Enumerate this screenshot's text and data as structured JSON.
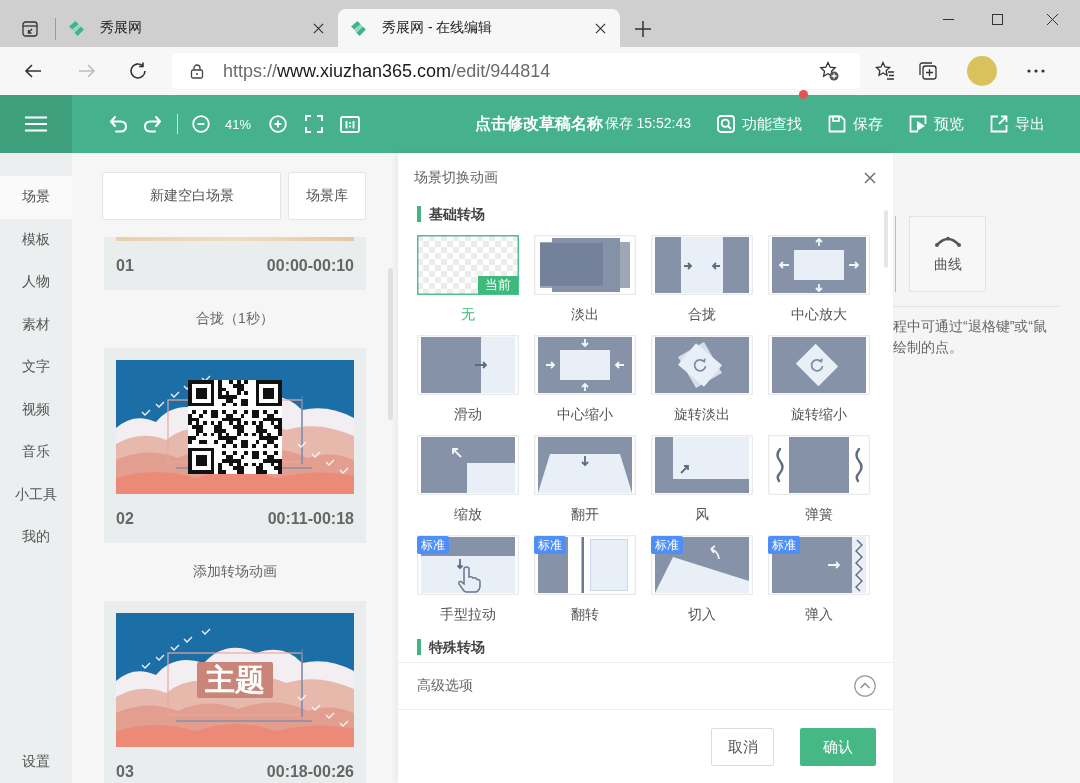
{
  "browser": {
    "tabs": [
      {
        "title": "秀展网",
        "selected": false
      },
      {
        "title": "秀展网 - 在线编辑",
        "selected": true
      }
    ],
    "nav": [
      {
        "kind": "back",
        "disabled": false
      },
      {
        "kind": "forward",
        "disabled": true
      },
      {
        "kind": "refresh",
        "disabled": false
      }
    ],
    "url": {
      "scheme": "https://",
      "host": "www.xiuzhan365.com",
      "path": "/edit/944814"
    }
  },
  "toolbar": {
    "zoom": "41%",
    "draft_name": "点击修改草稿名称",
    "save_status": "保存 15:52:43",
    "actions": [
      {
        "kind": "search",
        "label": "功能查找"
      },
      {
        "kind": "save",
        "label": "保存"
      },
      {
        "kind": "preview",
        "label": "预览"
      },
      {
        "kind": "export",
        "label": "导出"
      }
    ]
  },
  "sidebar": {
    "items": [
      {
        "label": "场景",
        "selected": true
      },
      {
        "label": "模板",
        "selected": false
      },
      {
        "label": "人物",
        "selected": false
      },
      {
        "label": "素材",
        "selected": false
      },
      {
        "label": "文字",
        "selected": false
      },
      {
        "label": "视频",
        "selected": false
      },
      {
        "label": "音乐",
        "selected": false
      },
      {
        "label": "小工具",
        "selected": false
      },
      {
        "label": "我的",
        "selected": false
      }
    ],
    "settings": "设置"
  },
  "scene_panel": {
    "buttons": [
      "新建空白场景",
      "场景库"
    ],
    "timeline": [
      {
        "kind": "scene",
        "number": "01",
        "time": "00:00-00:10",
        "thumbnail": {
          "kind": "strip"
        }
      },
      {
        "kind": "transition",
        "label": "合拢（1秒）"
      },
      {
        "kind": "scene",
        "number": "02",
        "time": "00:11-00:18",
        "thumbnail": {
          "kind": "qr_code"
        }
      },
      {
        "kind": "transition",
        "label": "添加转场动画"
      },
      {
        "kind": "scene",
        "number": "03",
        "time": "00:18-00:26",
        "thumbnail": {
          "kind": "title",
          "text": "主题"
        }
      }
    ]
  },
  "dialog": {
    "title": "场景切换动画",
    "sections": [
      {
        "heading": "基础转场",
        "effects": [
          {
            "kind": "none",
            "label": "无",
            "selected": true,
            "badge": {
              "kind": "current",
              "text": "当前"
            }
          },
          {
            "kind": "fade",
            "label": "淡出",
            "selected": false
          },
          {
            "kind": "close",
            "label": "合拢",
            "selected": false
          },
          {
            "kind": "zoom_in",
            "label": "中心放大",
            "selected": false
          },
          {
            "kind": "slide",
            "label": "滑动",
            "selected": false
          },
          {
            "kind": "zoom_out",
            "label": "中心缩小",
            "selected": false
          },
          {
            "kind": "rotate_fade",
            "label": "旋转淡出",
            "selected": false
          },
          {
            "kind": "rotate_shrink",
            "label": "旋转缩小",
            "selected": false
          },
          {
            "kind": "scale",
            "label": "缩放",
            "selected": false
          },
          {
            "kind": "unfold",
            "label": "翻开",
            "selected": false
          },
          {
            "kind": "wind",
            "label": "风",
            "selected": false
          },
          {
            "kind": "spring",
            "label": "弹簧",
            "selected": false
          },
          {
            "kind": "hand_drag",
            "label": "手型拉动",
            "selected": false,
            "badge": {
              "kind": "standard",
              "text": "标准"
            }
          },
          {
            "kind": "flip",
            "label": "翻转",
            "selected": false,
            "badge": {
              "kind": "standard",
              "text": "标准"
            }
          },
          {
            "kind": "cut_in",
            "label": "切入",
            "selected": false,
            "badge": {
              "kind": "standard",
              "text": "标准"
            }
          },
          {
            "kind": "bounce_in",
            "label": "弹入",
            "selected": false,
            "badge": {
              "kind": "standard",
              "text": "标准"
            }
          }
        ]
      },
      {
        "heading": "特殊转场"
      }
    ],
    "advanced_options": "高级选项",
    "buttons": [
      {
        "kind": "secondary",
        "label": "取消"
      },
      {
        "kind": "primary",
        "label": "确认"
      }
    ]
  },
  "right_panel": {
    "tools": [
      {
        "kind": "cut_off",
        "selected": true
      },
      {
        "kind": "curve",
        "label": "曲线",
        "selected": false
      }
    ],
    "hint_lines": [
      "程中可通过“退格键”或“鼠",
      "绘制的点。"
    ]
  }
}
